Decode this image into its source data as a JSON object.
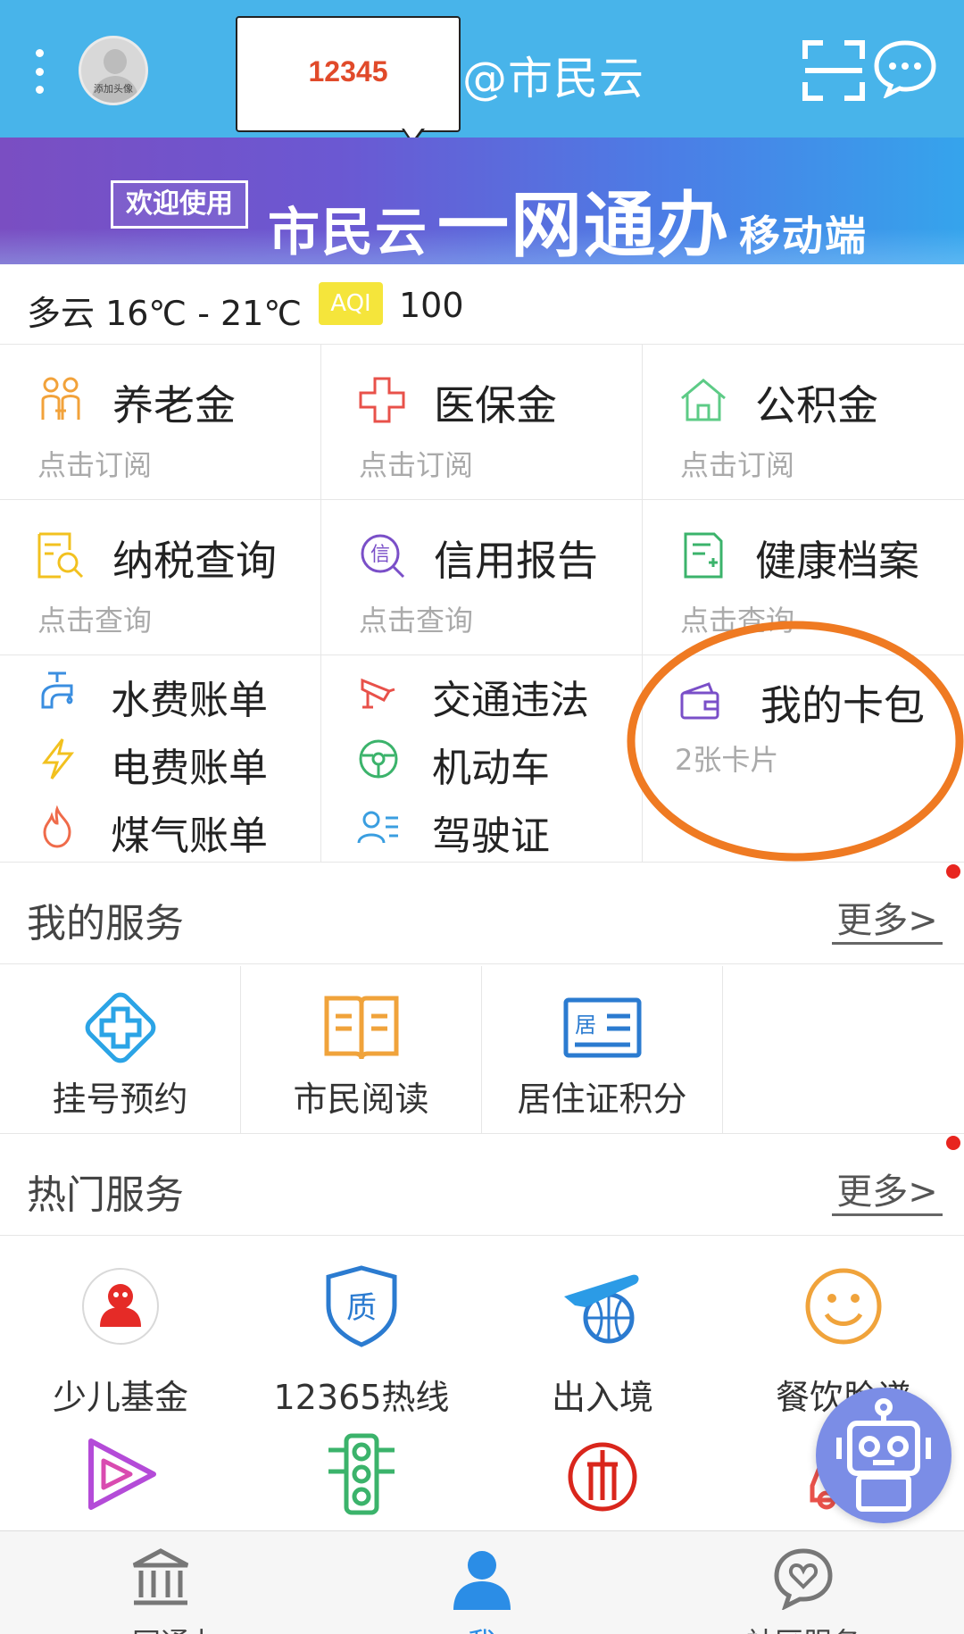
{
  "header": {
    "callout_text": "12345",
    "brand": "@市民云",
    "avatar_caption": "添加头像"
  },
  "banner": {
    "badge": "欢迎使用",
    "title_part1": "市民云",
    "title_part2": "一网通办",
    "title_part3": "移动端"
  },
  "weather": {
    "text": "多云 16℃ - 21℃",
    "aqi_label": "AQI",
    "aqi_value": "100"
  },
  "tiles_row1": [
    {
      "title": "养老金",
      "sub": "点击订阅",
      "icon": "family-icon"
    },
    {
      "title": "医保金",
      "sub": "点击订阅",
      "icon": "medical-cross-icon"
    },
    {
      "title": "公积金",
      "sub": "点击订阅",
      "icon": "house-icon"
    }
  ],
  "tiles_row2": [
    {
      "title": "纳税查询",
      "sub": "点击查询",
      "icon": "tax-search-icon"
    },
    {
      "title": "信用报告",
      "sub": "点击查询",
      "icon": "credit-icon"
    },
    {
      "title": "健康档案",
      "sub": "点击查询",
      "icon": "health-record-icon"
    }
  ],
  "bills": [
    {
      "label": "水费账单",
      "icon": "water-tap-icon"
    },
    {
      "label": "电费账单",
      "icon": "lightning-icon"
    },
    {
      "label": "煤气账单",
      "icon": "flame-icon"
    }
  ],
  "traffic": [
    {
      "label": "交通违法",
      "icon": "camera-icon"
    },
    {
      "label": "机动车",
      "icon": "steering-wheel-icon"
    },
    {
      "label": "驾驶证",
      "icon": "driver-license-icon"
    }
  ],
  "wallet": {
    "title": "我的卡包",
    "sub": "2张卡片"
  },
  "my_services": {
    "title": "我的服务",
    "more": "更多>",
    "items": [
      {
        "label": "挂号预约",
        "icon": "hospital-plus-icon"
      },
      {
        "label": "市民阅读",
        "icon": "book-icon"
      },
      {
        "label": "居住证积分",
        "icon": "residence-card-icon"
      }
    ]
  },
  "hot_services": {
    "title": "热门服务",
    "more": "更多>",
    "items": [
      {
        "label": "少儿基金",
        "icon": "children-fund-logo-icon"
      },
      {
        "label": "12365热线",
        "icon": "quality-shield-icon"
      },
      {
        "label": "出入境",
        "icon": "airplane-globe-icon"
      },
      {
        "label": "餐饮脸谱",
        "icon": "smiley-face-icon"
      }
    ],
    "items_row2_icons": [
      "play-icon",
      "traffic-light-icon",
      "national-emblem-icon",
      "car-icon"
    ]
  },
  "bottom_nav": [
    {
      "label": "一网通办",
      "icon": "government-building-icon"
    },
    {
      "label": "我",
      "icon": "person-icon",
      "active": true
    },
    {
      "label": "社区服务",
      "icon": "heart-chat-icon"
    }
  ],
  "colors": {
    "header_bg": "#48b4ea",
    "accent_orange": "#ef7a22",
    "nav_active": "#2b8de6",
    "red_dot": "#e8251f"
  }
}
